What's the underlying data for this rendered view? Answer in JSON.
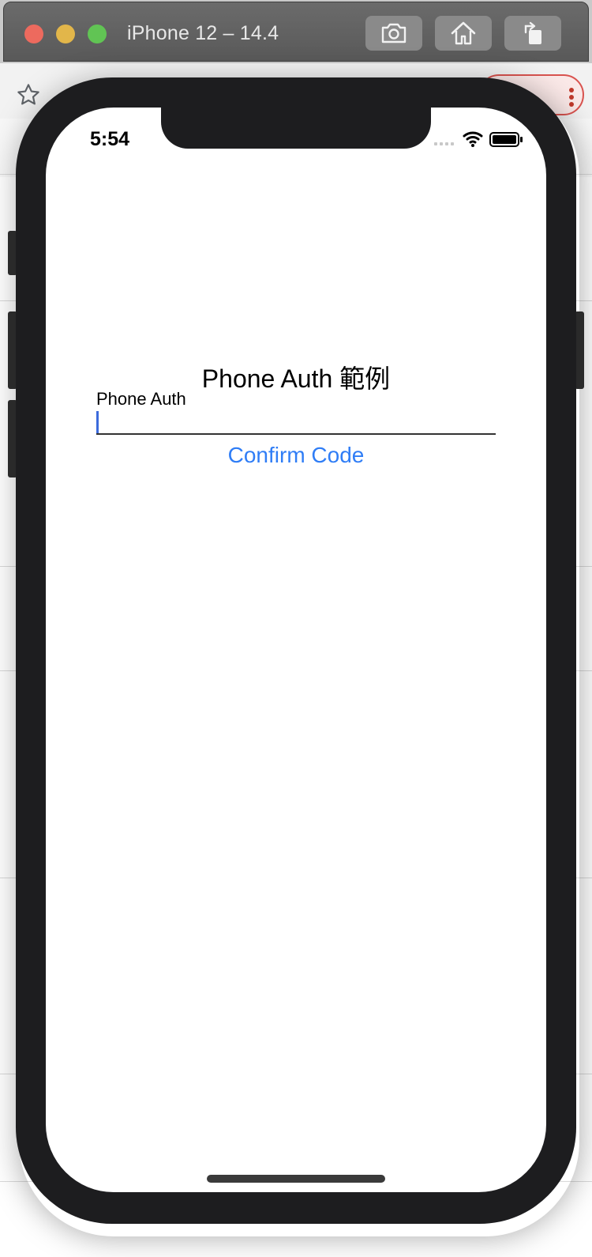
{
  "simulator": {
    "title": "iPhone 12 – 14.4",
    "window_buttons": [
      "close",
      "minimize",
      "maximize"
    ],
    "toolbar_icons": [
      "camera-icon",
      "home-icon",
      "rotate-icon"
    ]
  },
  "status_bar": {
    "time": "5:54",
    "icons": [
      "signal-icon",
      "wifi-icon",
      "battery-icon"
    ]
  },
  "app": {
    "title": "Phone Auth 範例",
    "input_label": "Phone Auth",
    "input_value": "",
    "confirm_label": "Confirm Code"
  },
  "colors": {
    "accent": "#2f7df6",
    "caret": "#3c6bdc",
    "device_frame": "#1d1d1f"
  }
}
